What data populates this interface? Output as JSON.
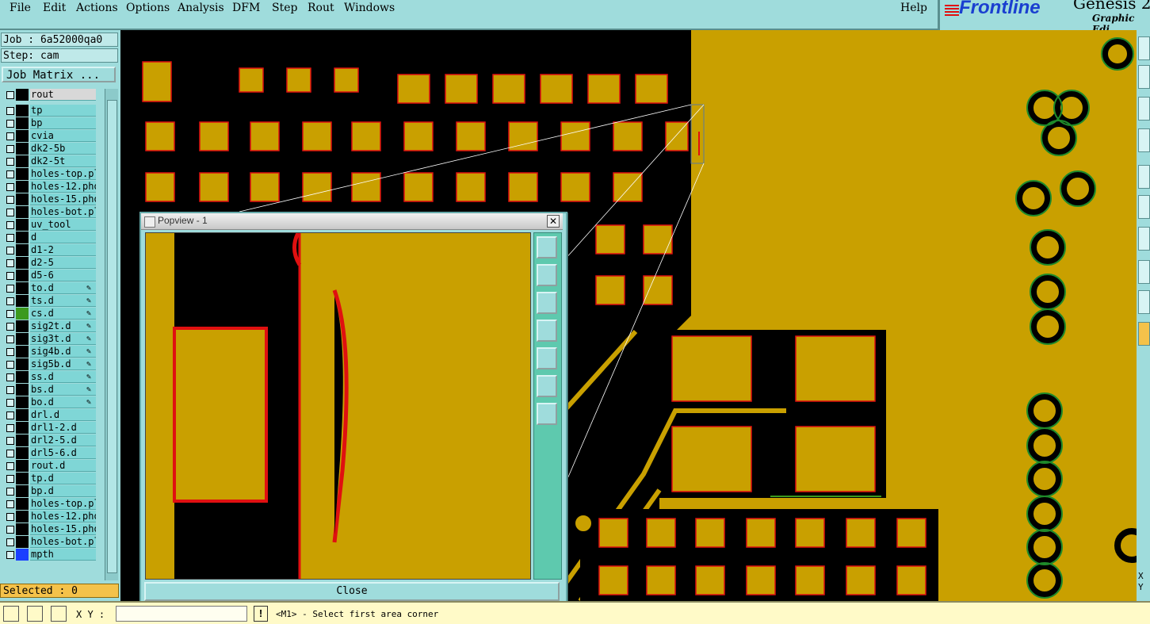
{
  "menu": [
    "File",
    "Edit",
    "Actions",
    "Options",
    "Analysis",
    "DFM",
    "Step",
    "Rout",
    "Windows"
  ],
  "help": "Help",
  "logo": {
    "brand": "Frontline",
    "product": "Genesis 2",
    "subtitle": "Graphic Edi"
  },
  "job": {
    "job_label": "Job : 6a52000qa0",
    "step_label": "Step: cam",
    "matrix_button": "Job Matrix ..."
  },
  "layers": [
    {
      "name": "rout",
      "color": "#000000",
      "selected": true
    },
    {
      "name": "tp",
      "color": "#000000"
    },
    {
      "name": "bp",
      "color": "#000000"
    },
    {
      "name": "cvia",
      "color": "#000000"
    },
    {
      "name": "dk2-5b",
      "color": "#000000"
    },
    {
      "name": "dk2-5t",
      "color": "#000000"
    },
    {
      "name": "holes-top.pl",
      "color": "#000000"
    },
    {
      "name": "holes-12.pho",
      "color": "#000000"
    },
    {
      "name": "holes-15.pho",
      "color": "#000000"
    },
    {
      "name": "holes-bot.pl",
      "color": "#000000"
    },
    {
      "name": "uv_tool",
      "color": "#000000"
    },
    {
      "name": "d",
      "color": "#000000"
    },
    {
      "name": "d1-2",
      "color": "#000000"
    },
    {
      "name": "d2-5",
      "color": "#000000"
    },
    {
      "name": "d5-6",
      "color": "#000000"
    },
    {
      "name": "to.d",
      "color": "#000000",
      "flag": true
    },
    {
      "name": "ts.d",
      "color": "#000000",
      "flag": true
    },
    {
      "name": "cs.d",
      "color": "#3c9a1e",
      "flag": true
    },
    {
      "name": "sig2t.d",
      "color": "#000000",
      "flag": true
    },
    {
      "name": "sig3t.d",
      "color": "#000000",
      "flag": true
    },
    {
      "name": "sig4b.d",
      "color": "#000000",
      "flag": true
    },
    {
      "name": "sig5b.d",
      "color": "#000000",
      "flag": true
    },
    {
      "name": "ss.d",
      "color": "#000000",
      "flag": true
    },
    {
      "name": "bs.d",
      "color": "#000000",
      "flag": true
    },
    {
      "name": "bo.d",
      "color": "#000000",
      "flag": true
    },
    {
      "name": "drl.d",
      "color": "#000000"
    },
    {
      "name": "drl1-2.d",
      "color": "#000000"
    },
    {
      "name": "drl2-5.d",
      "color": "#000000"
    },
    {
      "name": "drl5-6.d",
      "color": "#000000"
    },
    {
      "name": "rout.d",
      "color": "#000000"
    },
    {
      "name": "tp.d",
      "color": "#000000"
    },
    {
      "name": "bp.d",
      "color": "#000000"
    },
    {
      "name": "holes-top.pl",
      "color": "#000000"
    },
    {
      "name": "holes-12.pho",
      "color": "#000000"
    },
    {
      "name": "holes-15.pho",
      "color": "#000000"
    },
    {
      "name": "holes-bot.pl",
      "color": "#000000"
    },
    {
      "name": "mpth",
      "color": "#1a3fff"
    }
  ],
  "selected_count": "Selected : 0",
  "popview": {
    "title": "Popview - 1",
    "close_label": "Close"
  },
  "statusbar": {
    "xy_label": "X Y :",
    "xy_value": "",
    "prompt": "<M1> - Select first area corner"
  },
  "side_readout": "X Y",
  "colors": {
    "board": "#c9a000",
    "copper_edge": "#e01010",
    "panel": "#9fdcdc",
    "status": "#fffac8",
    "selected_box": "#f4c24a"
  }
}
